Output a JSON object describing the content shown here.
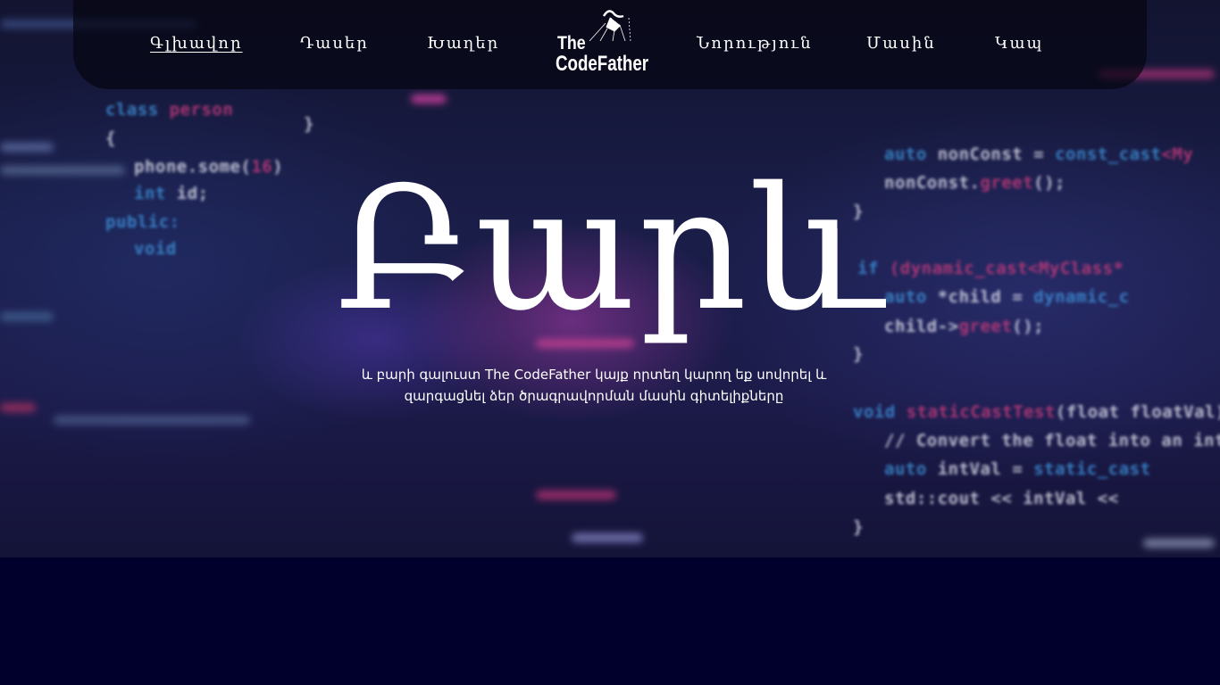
{
  "nav": {
    "items": [
      {
        "label": "Գլխավոր",
        "active": true
      },
      {
        "label": "Դասեր",
        "active": false
      },
      {
        "label": "Խաղեր",
        "active": false
      },
      {
        "label": "Նորություն",
        "active": false
      },
      {
        "label": "Մասին",
        "active": false
      },
      {
        "label": "Կապ",
        "active": false
      }
    ],
    "logo": {
      "line1": "The",
      "line2": "CodeFather"
    }
  },
  "hero": {
    "title": "Բարև",
    "subtitle": "և բարի գալուստ The CodeFather կայք որտեղ կարող եք սովորել և զարգացնել ձեր ծրագրավորման մասին գիտելիքները"
  },
  "colors": {
    "page_background": "#01002d",
    "text": "#ffffff",
    "nav_background": "rgba(5,6,18,0.72)",
    "code_keyword": "#3d8fd6",
    "code_accent": "#c23a7a"
  }
}
